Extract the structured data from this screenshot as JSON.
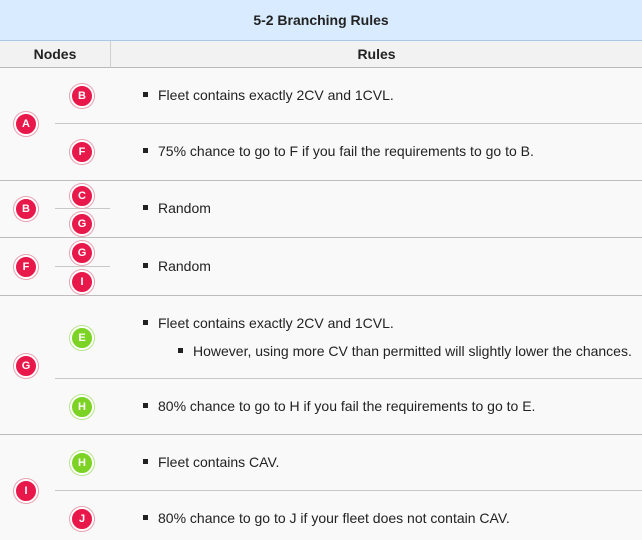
{
  "title": "5-2 Branching Rules",
  "headers": {
    "nodes": "Nodes",
    "rules": "Rules"
  },
  "colors": {
    "red_node": "#e8184a",
    "green_node": "#7dd323",
    "title_bg": "#d9ecff"
  },
  "groups": [
    {
      "node": "A",
      "branches": [
        {
          "node": "B",
          "rule": "Fleet contains exactly 2CV and 1CVL."
        },
        {
          "node": "F",
          "rule": "75% chance to go to F if you fail the requirements to go to B."
        }
      ]
    },
    {
      "node": "B",
      "branches": [
        {
          "node": "C"
        },
        {
          "node": "G"
        }
      ],
      "rule": "Random"
    },
    {
      "node": "F",
      "branches": [
        {
          "node": "G"
        },
        {
          "node": "I"
        }
      ],
      "rule": "Random"
    },
    {
      "node": "G",
      "branches": [
        {
          "node": "E",
          "rule": "Fleet contains exactly 2CV and 1CVL.",
          "subrule": "However, using more CV than permitted will slightly lower the chances."
        },
        {
          "node": "H",
          "rule": "80% chance to go to H if you fail the requirements to go to E."
        }
      ]
    },
    {
      "node": "I",
      "branches": [
        {
          "node": "H",
          "rule": "Fleet contains CAV."
        },
        {
          "node": "J",
          "rule": "80% chance to go to J if your fleet does not contain CAV."
        }
      ]
    }
  ]
}
